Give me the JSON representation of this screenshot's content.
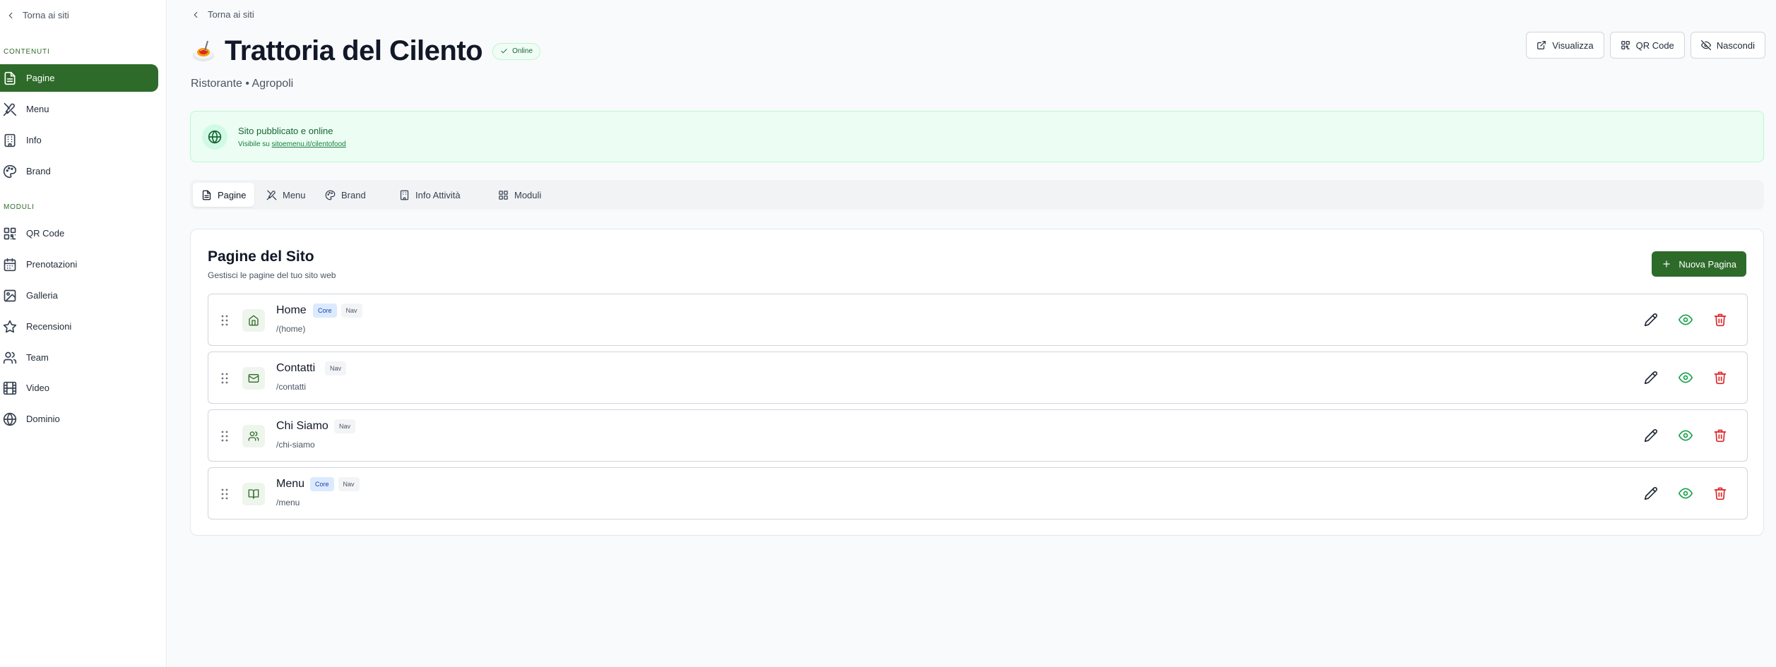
{
  "sidebar": {
    "back_label": "Torna ai siti",
    "sections": [
      {
        "title": "CONTENUTI",
        "items": [
          {
            "label": "Pagine",
            "icon": "file-text-icon",
            "active": true
          },
          {
            "label": "Menu",
            "icon": "utensils-icon"
          },
          {
            "label": "Info",
            "icon": "building-icon"
          },
          {
            "label": "Brand",
            "icon": "palette-icon"
          }
        ]
      },
      {
        "title": "MODULI",
        "items": [
          {
            "label": "QR Code",
            "icon": "qr-code-icon"
          },
          {
            "label": "Prenotazioni",
            "icon": "calendar-icon"
          },
          {
            "label": "Galleria",
            "icon": "image-icon"
          },
          {
            "label": "Recensioni",
            "icon": "star-icon"
          },
          {
            "label": "Team",
            "icon": "users-icon"
          },
          {
            "label": "Video",
            "icon": "film-icon"
          },
          {
            "label": "Dominio",
            "icon": "globe-icon"
          }
        ]
      }
    ]
  },
  "header": {
    "breadcrumb": "Torna ai siti",
    "title": "Trattoria del Cilento",
    "status_badge": "Online",
    "subtitle": "Ristorante • Agropoli",
    "actions": {
      "view": "Visualizza",
      "qr": "QR Code",
      "hide": "Nascondi"
    }
  },
  "status": {
    "title": "Sito pubblicato e online",
    "visible_prefix": "Visibile su",
    "url": "sitoemenu.it/cilentofood"
  },
  "tabs": [
    {
      "label": "Pagine",
      "icon": "file-text-icon",
      "active": true
    },
    {
      "label": "Menu",
      "icon": "utensils-icon"
    },
    {
      "label": "Brand",
      "icon": "palette-icon"
    },
    {
      "label": "Info Attività",
      "icon": "building-icon"
    },
    {
      "label": "Moduli",
      "icon": "grid-icon"
    }
  ],
  "pages_panel": {
    "title": "Pagine del Sito",
    "subtitle": "Gestisci le pagine del tuo sito web",
    "new_button": "Nuova Pagina",
    "rows": [
      {
        "name": "Home",
        "path": "/(home)",
        "tags": [
          "Core",
          "Nav"
        ],
        "icon": "home-icon"
      },
      {
        "name": "Contatti",
        "path": "/contatti",
        "tags": [
          "Nav"
        ],
        "icon": "mail-icon"
      },
      {
        "name": "Chi Siamo",
        "path": "/chi-siamo",
        "tags": [
          "Nav"
        ],
        "icon": "users-icon"
      },
      {
        "name": "Menu",
        "path": "/menu",
        "tags": [
          "Core",
          "Nav"
        ],
        "icon": "book-open-icon"
      }
    ]
  },
  "colors": {
    "brand_green": "#2e6b2a",
    "success_bg": "#ecfdf3",
    "delete_red": "#dc2626",
    "view_green": "#16a34a"
  }
}
